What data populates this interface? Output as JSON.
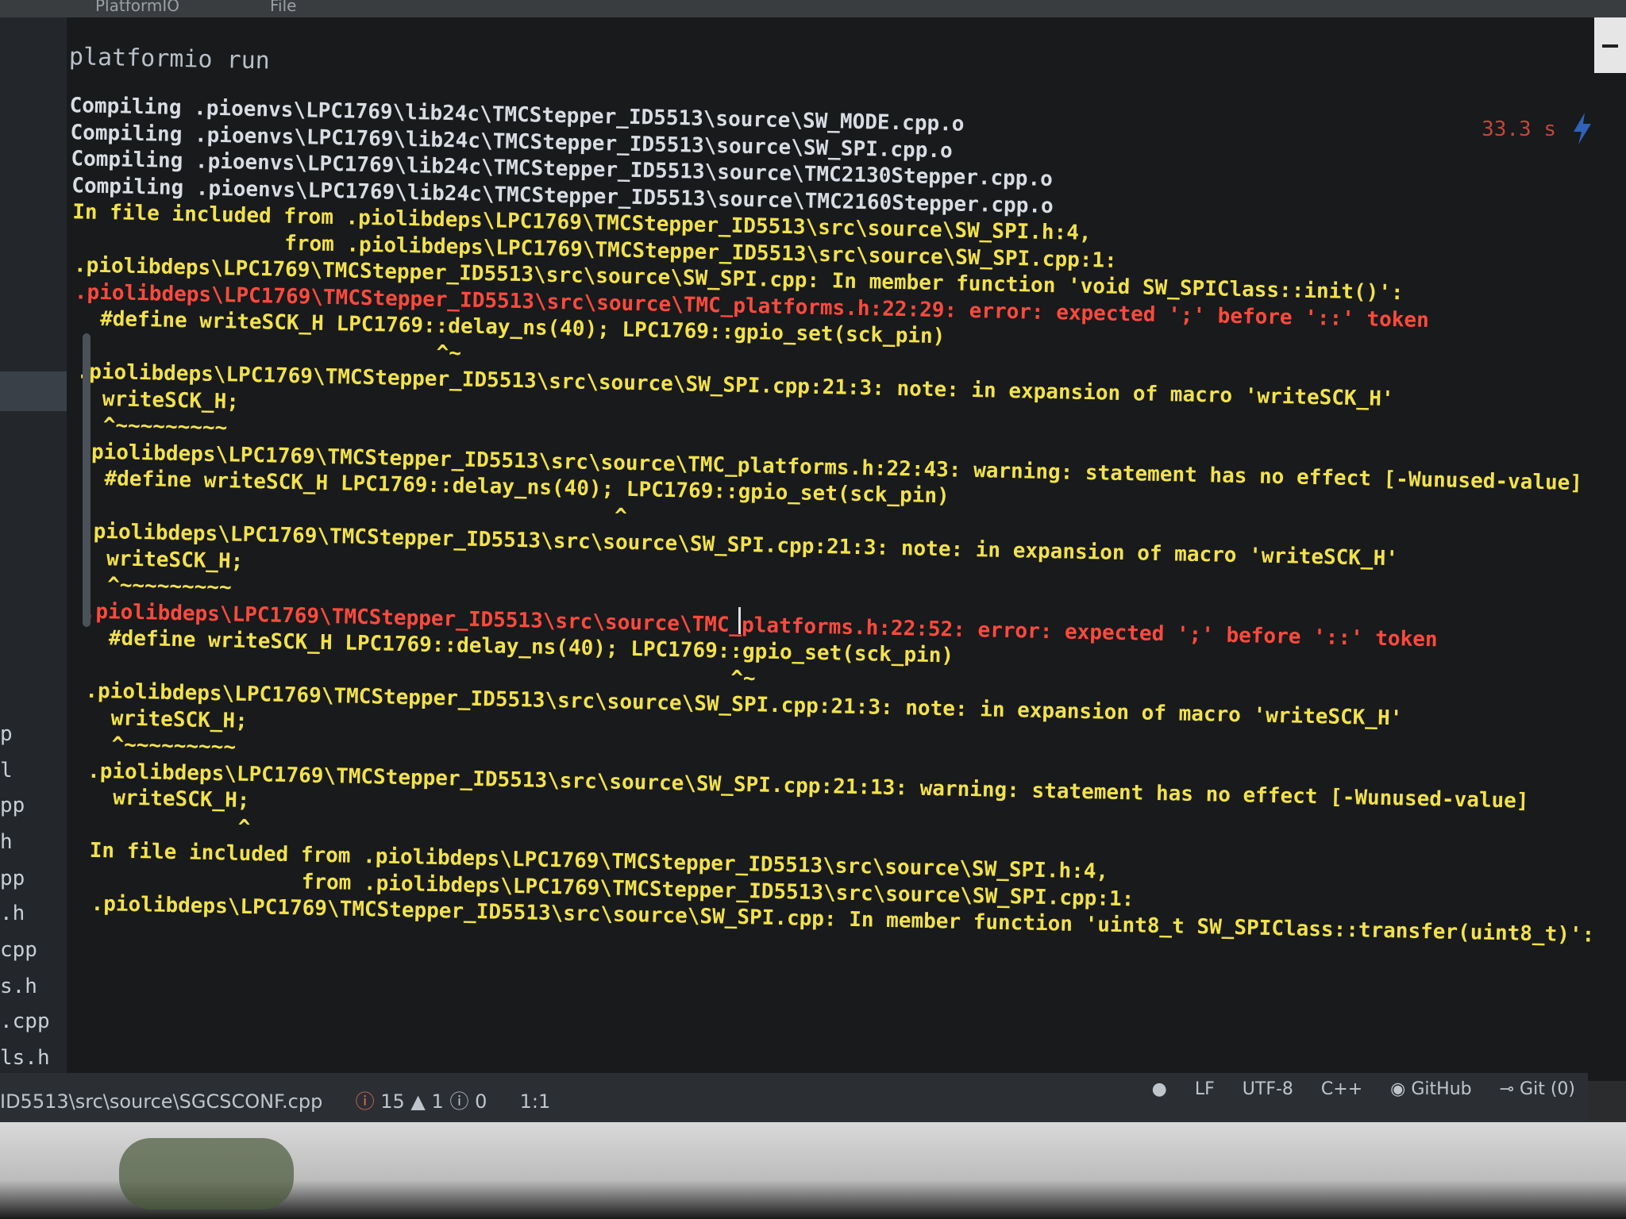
{
  "menubar": {
    "items": [
      "PlatformIO",
      "File"
    ]
  },
  "terminal": {
    "command": "platformio run",
    "elapsed": "33.3 s",
    "lines": [
      {
        "t": "Compiling .pioenvs\\LPC1769\\lib24c\\TMCStepper_ID5513\\source\\SW_MODE.cpp.o",
        "c": "white"
      },
      {
        "t": "Compiling .pioenvs\\LPC1769\\lib24c\\TMCStepper_ID5513\\source\\SW_SPI.cpp.o",
        "c": "white"
      },
      {
        "t": "Compiling .pioenvs\\LPC1769\\lib24c\\TMCStepper_ID5513\\source\\TMC2130Stepper.cpp.o",
        "c": "white"
      },
      {
        "t": "Compiling .pioenvs\\LPC1769\\lib24c\\TMCStepper_ID5513\\source\\TMC2160Stepper.cpp.o",
        "c": "white"
      },
      {
        "t": "In file included from .piolibdeps\\LPC1769\\TMCStepper_ID5513\\src\\source\\SW_SPI.h:4,",
        "c": "yellow"
      },
      {
        "t": "                 from .piolibdeps\\LPC1769\\TMCStepper_ID5513\\src\\source\\SW_SPI.cpp:1:",
        "c": "yellow"
      },
      {
        "t": ".piolibdeps\\LPC1769\\TMCStepper_ID5513\\src\\source\\SW_SPI.cpp: In member function 'void SW_SPIClass::init()':",
        "c": "yellow"
      },
      {
        "t": ".piolibdeps\\LPC1769\\TMCStepper_ID5513\\src\\source\\TMC_platforms.h:22:29: error: expected ';' before '::' token",
        "c": "red"
      },
      {
        "t": "  #define writeSCK_H LPC1769::delay_ns(40); LPC1769::gpio_set(sck_pin)",
        "c": "yellow"
      },
      {
        "t": "                             ^~",
        "c": "yellow"
      },
      {
        "t": ".piolibdeps\\LPC1769\\TMCStepper_ID5513\\src\\source\\SW_SPI.cpp:21:3: note: in expansion of macro 'writeSCK_H'",
        "c": "yellow"
      },
      {
        "t": "  writeSCK_H;",
        "c": "yellow"
      },
      {
        "t": "  ^~~~~~~~~~",
        "c": "yellow"
      },
      {
        "t": ".piolibdeps\\LPC1769\\TMCStepper_ID5513\\src\\source\\TMC_platforms.h:22:43: warning: statement has no effect [-Wunused-value]",
        "c": "yellow"
      },
      {
        "t": "  #define writeSCK_H LPC1769::delay_ns(40); LPC1769::gpio_set(sck_pin)",
        "c": "yellow"
      },
      {
        "t": "                                           ^",
        "c": "yellow"
      },
      {
        "t": ".piolibdeps\\LPC1769\\TMCStepper_ID5513\\src\\source\\SW_SPI.cpp:21:3: note: in expansion of macro 'writeSCK_H'",
        "c": "yellow"
      },
      {
        "t": "  writeSCK_H;",
        "c": "yellow"
      },
      {
        "t": "  ^~~~~~~~~~",
        "c": "yellow"
      },
      {
        "t": ".piolibdeps\\LPC1769\\TMCStepper_ID5513\\src\\source\\TMC_platforms.h:22:52: error: expected ';' before '::' token",
        "c": "red"
      },
      {
        "t": "  #define writeSCK_H LPC1769::delay_ns(40); LPC1769::gpio_set(sck_pin)",
        "c": "yellow"
      },
      {
        "t": "                                                    ^~",
        "c": "yellow"
      },
      {
        "t": ".piolibdeps\\LPC1769\\TMCStepper_ID5513\\src\\source\\SW_SPI.cpp:21:3: note: in expansion of macro 'writeSCK_H'",
        "c": "yellow"
      },
      {
        "t": "  writeSCK_H;",
        "c": "yellow"
      },
      {
        "t": "  ^~~~~~~~~~",
        "c": "yellow"
      },
      {
        "t": ".piolibdeps\\LPC1769\\TMCStepper_ID5513\\src\\source\\SW_SPI.cpp:21:13: warning: statement has no effect [-Wunused-value]",
        "c": "yellow"
      },
      {
        "t": "  writeSCK_H;",
        "c": "yellow"
      },
      {
        "t": "            ^",
        "c": "yellow"
      },
      {
        "t": "In file included from .piolibdeps\\LPC1769\\TMCStepper_ID5513\\src\\source\\SW_SPI.h:4,",
        "c": "yellow"
      },
      {
        "t": "                 from .piolibdeps\\LPC1769\\TMCStepper_ID5513\\src\\source\\SW_SPI.cpp:1:",
        "c": "yellow"
      },
      {
        "t": ".piolibdeps\\LPC1769\\TMCStepper_ID5513\\src\\source\\SW_SPI.cpp: In member function 'uint8_t SW_SPIClass::transfer(uint8_t)':",
        "c": "yellow"
      }
    ]
  },
  "sidebar": {
    "fragments": [
      "p",
      "l",
      "pp",
      "h",
      "pp",
      ".h",
      "cpp",
      "s.h",
      ".cpp",
      "ls.h"
    ]
  },
  "statusbar": {
    "file_path": "ID5513\\src\\source\\SGCSCONF.cpp",
    "errors": "15",
    "warnings": "1",
    "infos": "0",
    "cursor_pos": "1:1",
    "line_ending": "LF",
    "encoding": "UTF-8",
    "language": "C++",
    "github": "GitHub",
    "git": "Git (0)"
  }
}
